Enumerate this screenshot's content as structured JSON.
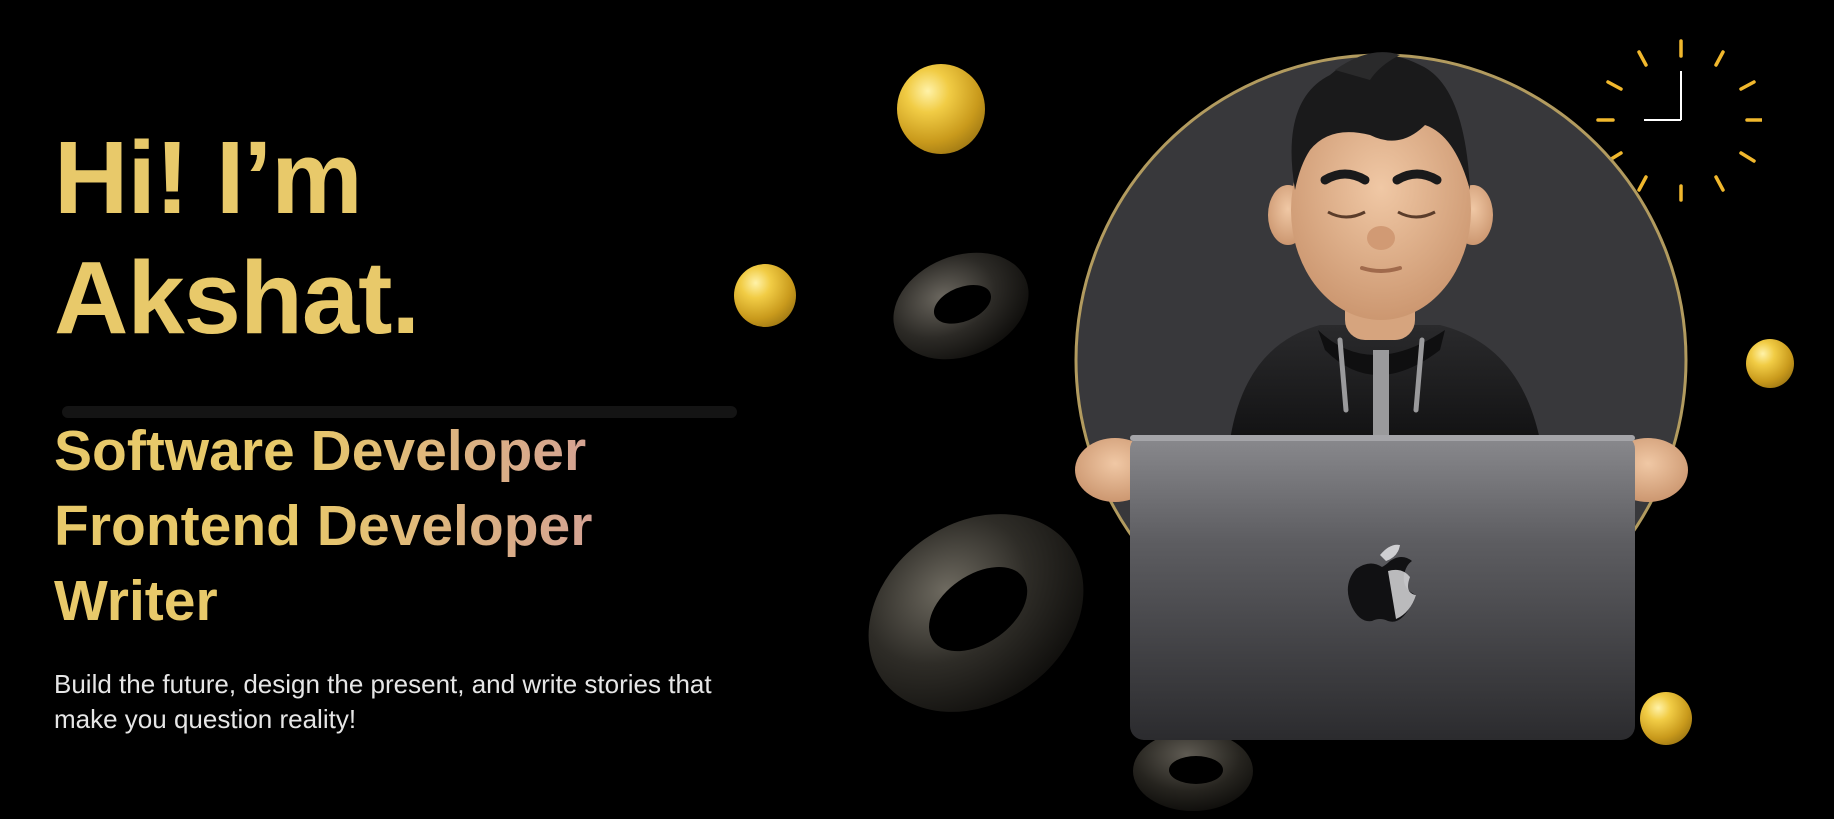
{
  "hero": {
    "greeting_line1": "Hi! I’m",
    "greeting_line2": "Akshat."
  },
  "roles": [
    "Software Developer",
    "Frontend Developer",
    "Writer"
  ],
  "tagline": {
    "line1": "Build the future, design the present, and write stories that",
    "line2": "make you question reality!"
  },
  "icons": {
    "laptop_logo": "apple-logo-icon",
    "clock": "clock-icon"
  },
  "colors": {
    "background": "#000000",
    "accent_gold": "#e8c96a",
    "accent_rose": "#d4a293",
    "text_light": "#e6e6e6"
  }
}
